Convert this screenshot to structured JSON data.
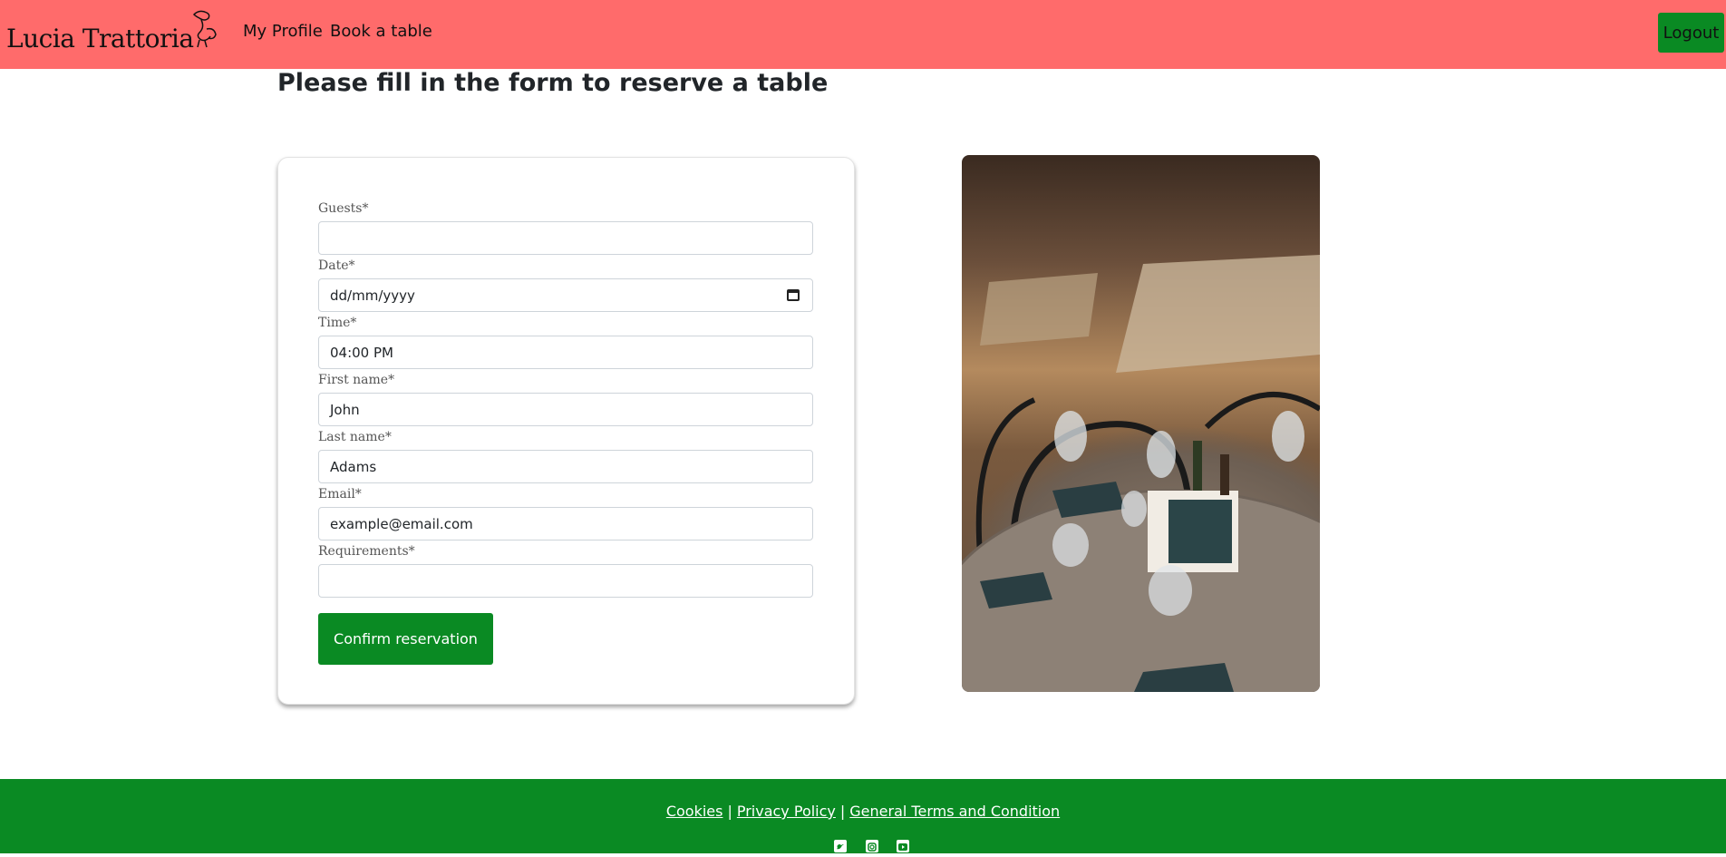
{
  "nav": {
    "brand": "Lucia Trattoria",
    "links": [
      {
        "label": "My Profile"
      },
      {
        "label": "Book a table"
      }
    ],
    "logout_label": "Logout",
    "background_color": "#ff6b6b"
  },
  "page": {
    "title": "Please fill in the form to reserve a table"
  },
  "form": {
    "fields": [
      {
        "label": "Guests*",
        "value": ""
      },
      {
        "label": "Date*",
        "value": "dd/mm/yyyy"
      },
      {
        "label": "Time*",
        "value": "04:00 PM"
      },
      {
        "label": "First name*",
        "value": "John"
      },
      {
        "label": "Last name*",
        "value": "Adams"
      },
      {
        "label": "Email*",
        "value": "example@email.com"
      },
      {
        "label": "Requirements*",
        "value": ""
      }
    ],
    "submit_label": "Confirm reservation"
  },
  "footer": {
    "links": [
      {
        "label": "Cookies"
      },
      {
        "label": "Privacy Policy"
      },
      {
        "label": "General Terms and Condition"
      }
    ],
    "separator": "|",
    "social_icons": [
      "twitter-icon",
      "instagram-icon",
      "youtube-icon"
    ],
    "background_color": "#0a8a23"
  },
  "colors": {
    "accent_green": "#0a8a23",
    "nav_red": "#ff6b6b"
  }
}
